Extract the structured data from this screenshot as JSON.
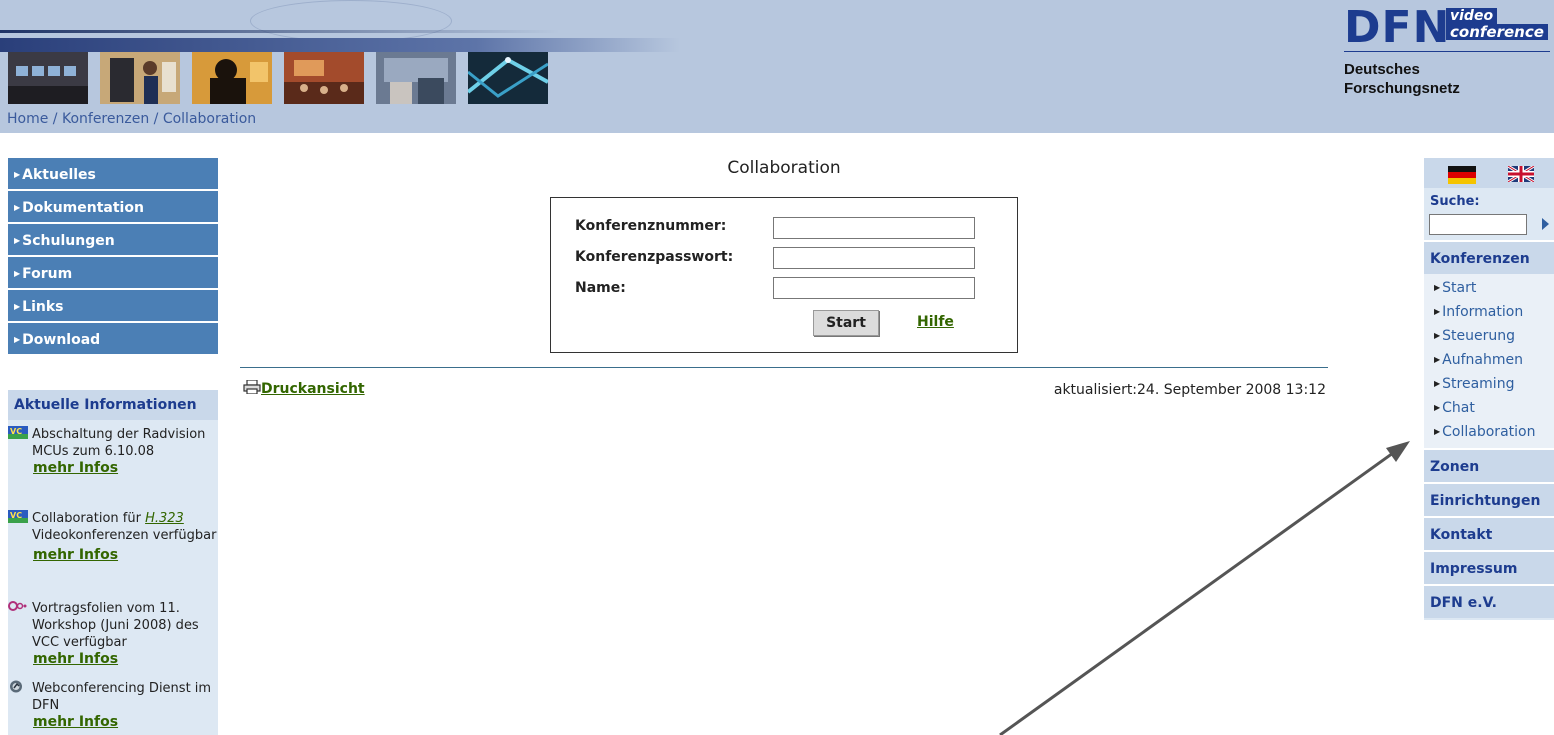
{
  "header": {
    "logo_main": "DFN",
    "logo_video": "video",
    "logo_conference": "conference",
    "logo_org_line1": "Deutsches",
    "logo_org_line2": "Forschungsnetz"
  },
  "breadcrumb": [
    "Home",
    "Konferenzen",
    "Collaboration"
  ],
  "left_nav": [
    "Aktuelles",
    "Dokumentation",
    "Schulungen",
    "Forum",
    "Links",
    "Download"
  ],
  "info": {
    "title": "Aktuelle Informationen",
    "items": [
      {
        "text": "Abschaltung der Radvision MCUs zum 6.10.08",
        "more": "mehr Infos",
        "icon": "vc-icon"
      },
      {
        "text_pre": "Collaboration für ",
        "text_link": "H.323",
        "text_post": "Videokonferenzen verfügbar",
        "more": "mehr Infos",
        "icon": "vc-icon"
      },
      {
        "text": "Vortragsfolien vom 11. Workshop (Juni 2008) des VCC verfügbar",
        "more": "mehr Infos",
        "icon": "slides-icon"
      },
      {
        "text": "Webconferencing Dienst im DFN",
        "more": "mehr Infos",
        "icon": "webconf-icon"
      }
    ]
  },
  "main": {
    "title": "Collaboration",
    "form": {
      "labels": [
        "Konferenznummer:",
        "Konferenzpasswort:",
        "Name:"
      ],
      "values": [
        "",
        "",
        ""
      ],
      "start_label": "Start",
      "help_label": "Hilfe"
    },
    "print_label": "Druckansicht",
    "updated": "aktualisiert:24. September 2008 13:12"
  },
  "right": {
    "search_label": "Suche:",
    "search_value": "",
    "sections": [
      "Konferenzen",
      "Zonen",
      "Einrichtungen",
      "Kontakt",
      "Impressum",
      "DFN e.V."
    ],
    "konferenzen_items": [
      "Start",
      "Information",
      "Steuerung",
      "Aufnahmen",
      "Streaming",
      "Chat",
      "Collaboration"
    ]
  },
  "colors": {
    "banner": "#b7c7de",
    "nav_blue": "#4b7fb5",
    "link_green": "#336600",
    "dfn_blue": "#1d3c8f"
  }
}
